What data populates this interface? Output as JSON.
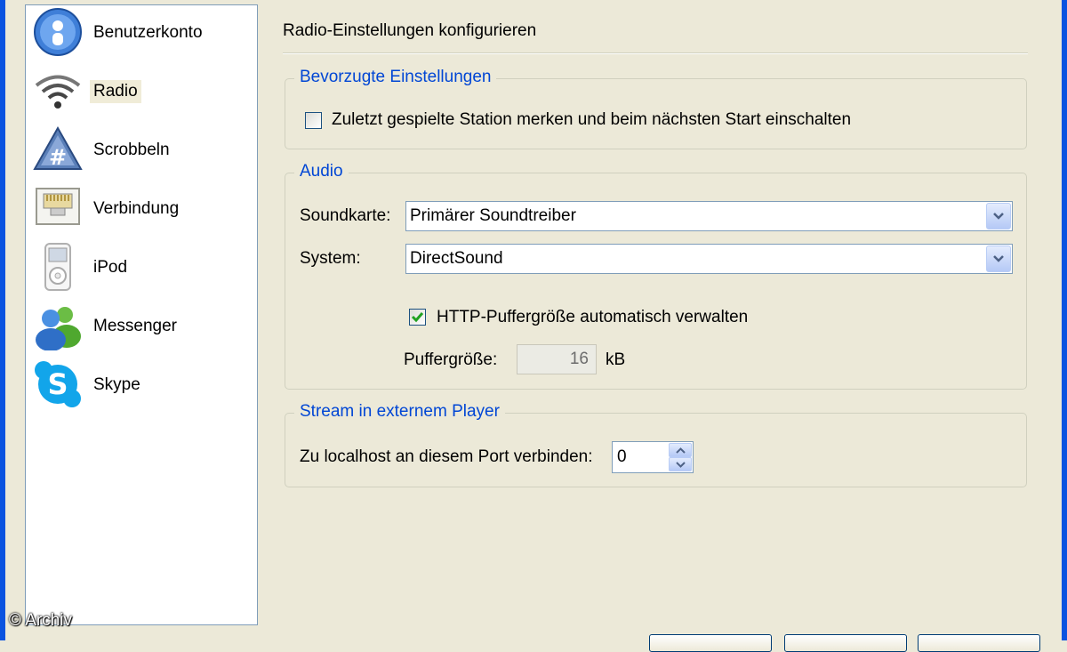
{
  "sidebar": {
    "items": [
      {
        "label": "Benutzerkonto",
        "icon": "user-account-icon"
      },
      {
        "label": "Radio",
        "icon": "wifi-signal-icon",
        "selected": true
      },
      {
        "label": "Scrobbeln",
        "icon": "scrobble-hash-icon"
      },
      {
        "label": "Verbindung",
        "icon": "network-port-icon"
      },
      {
        "label": "iPod",
        "icon": "ipod-icon"
      },
      {
        "label": "Messenger",
        "icon": "messenger-users-icon"
      },
      {
        "label": "Skype",
        "icon": "skype-icon"
      }
    ]
  },
  "main": {
    "title": "Radio-Einstellungen konfigurieren",
    "preferred": {
      "legend": "Bevorzugte Einstellungen",
      "remember_station": {
        "label": "Zuletzt gespielte Station merken und beim nächsten Start einschalten",
        "checked": false
      }
    },
    "audio": {
      "legend": "Audio",
      "soundcard": {
        "label": "Soundkarte:",
        "value": "Primärer Soundtreiber"
      },
      "system": {
        "label": "System:",
        "value": "DirectSound"
      },
      "http_buffer_auto": {
        "label": "HTTP-Puffergröße automatisch verwalten",
        "checked": true
      },
      "buffer_size": {
        "label": "Puffergröße:",
        "value": "16",
        "unit": "kB"
      }
    },
    "stream": {
      "legend": "Stream in externem Player",
      "port": {
        "label": "Zu localhost an diesem Port verbinden:",
        "value": "0"
      }
    }
  },
  "watermark": "© Archiv",
  "colors": {
    "legend": "#0046d5",
    "window_border": "#0a53e0",
    "dialog_bg": "#ece9d8",
    "selected_item_bg": "#f0ecd8",
    "check_mark": "#21a121"
  }
}
